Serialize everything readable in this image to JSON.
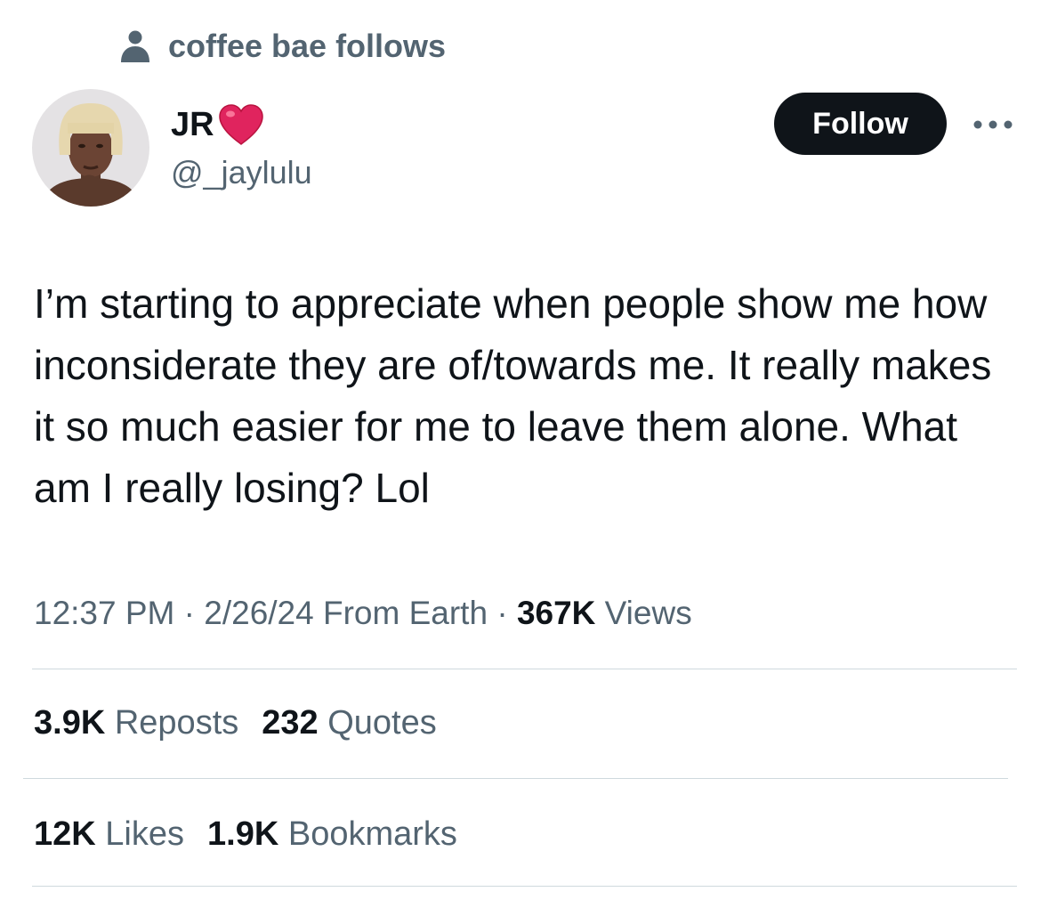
{
  "social_context": {
    "icon": "person-icon",
    "text": "coffee bae follows"
  },
  "author": {
    "display_name": "JR",
    "emoji": "heart-emoji",
    "handle": "@_jaylulu",
    "avatar": "avatar-photo"
  },
  "follow_button": {
    "label": "Follow"
  },
  "more_button": {
    "icon": "more-dots-icon"
  },
  "tweet": {
    "text": "I’m starting to appreciate when people show me how inconsiderate they are of/towards me. It really makes it so much easier for me to leave them alone. What am I really losing? Lol",
    "time": "12:37 PM",
    "separator1": " · ",
    "date": "2/26/24",
    "location": "From Earth",
    "separator2": " · ",
    "views_count": "367K",
    "views_label": "Views"
  },
  "stats": {
    "reposts_count": "3.9K",
    "reposts_label": "Reposts",
    "quotes_count": "232",
    "quotes_label": "Quotes",
    "likes_count": "12K",
    "likes_label": "Likes",
    "bookmarks_count": "1.9K",
    "bookmarks_label": "Bookmarks"
  },
  "colors": {
    "primary_text": "#0f1419",
    "secondary_text": "#536471",
    "divider": "#cfd9de",
    "button_bg": "#0f1419",
    "heart": "#e0245e"
  }
}
